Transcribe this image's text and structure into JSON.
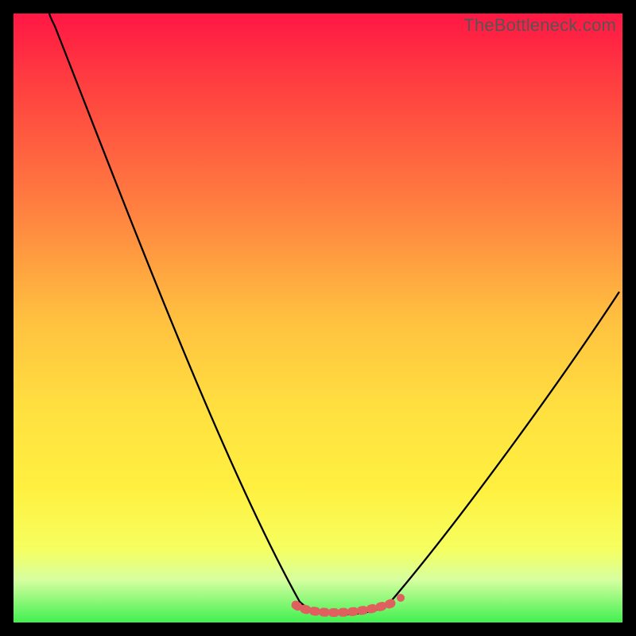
{
  "watermark": "TheBottleneck.com",
  "chart_data": {
    "type": "line",
    "title": "",
    "xlabel": "",
    "ylabel": "",
    "x": [
      0.0,
      0.05,
      0.1,
      0.15,
      0.2,
      0.25,
      0.3,
      0.35,
      0.4,
      0.45,
      0.5,
      0.55,
      0.6,
      0.65,
      0.7,
      0.75,
      0.8,
      0.85,
      0.9,
      0.95,
      1.0
    ],
    "values": [
      1.0,
      0.87,
      0.74,
      0.62,
      0.5,
      0.39,
      0.28,
      0.18,
      0.1,
      0.05,
      0.02,
      0.01,
      0.01,
      0.02,
      0.04,
      0.08,
      0.14,
      0.22,
      0.31,
      0.42,
      0.55
    ],
    "xlim": [
      0,
      1
    ],
    "ylim": [
      0,
      1
    ],
    "minimum_band": {
      "x_start": 0.5,
      "x_end": 0.64,
      "y": 0.0
    },
    "notes": "V-shaped bottleneck curve; optimum flat region around x ≈ 0.50–0.64, watermark top-right"
  }
}
